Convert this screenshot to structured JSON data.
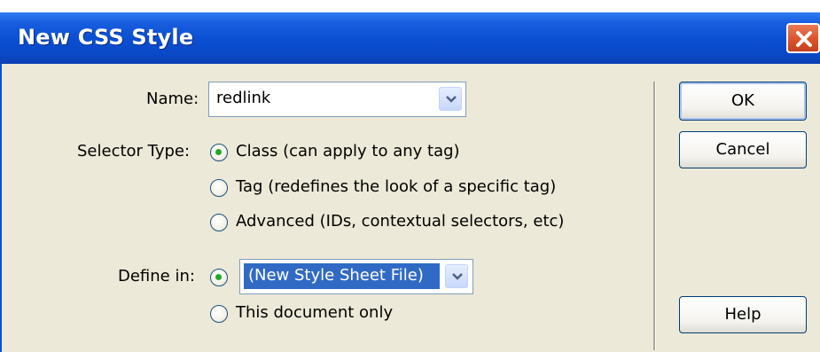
{
  "window": {
    "title": "New CSS Style"
  },
  "form": {
    "name_label": "Name:",
    "name_value": "redlink",
    "selector_type_label": "Selector Type:",
    "selector_options": [
      {
        "label": "Class (can apply to any tag)",
        "checked": true
      },
      {
        "label": "Tag (redefines the look of a specific tag)",
        "checked": false
      },
      {
        "label": "Advanced (IDs, contextual selectors, etc)",
        "checked": false
      }
    ],
    "define_in_label": "Define in:",
    "define_in_options": [
      {
        "label": "(New Style Sheet File)",
        "checked": true
      },
      {
        "label": "This document only",
        "checked": false
      }
    ]
  },
  "buttons": {
    "ok": "OK",
    "cancel": "Cancel",
    "help": "Help"
  },
  "colors": {
    "titlebar": "#0a49c8",
    "dialog_bg": "#ece9d8",
    "selection": "#316ac5",
    "close_button": "#d9502a",
    "radio_dot": "#23a923"
  }
}
